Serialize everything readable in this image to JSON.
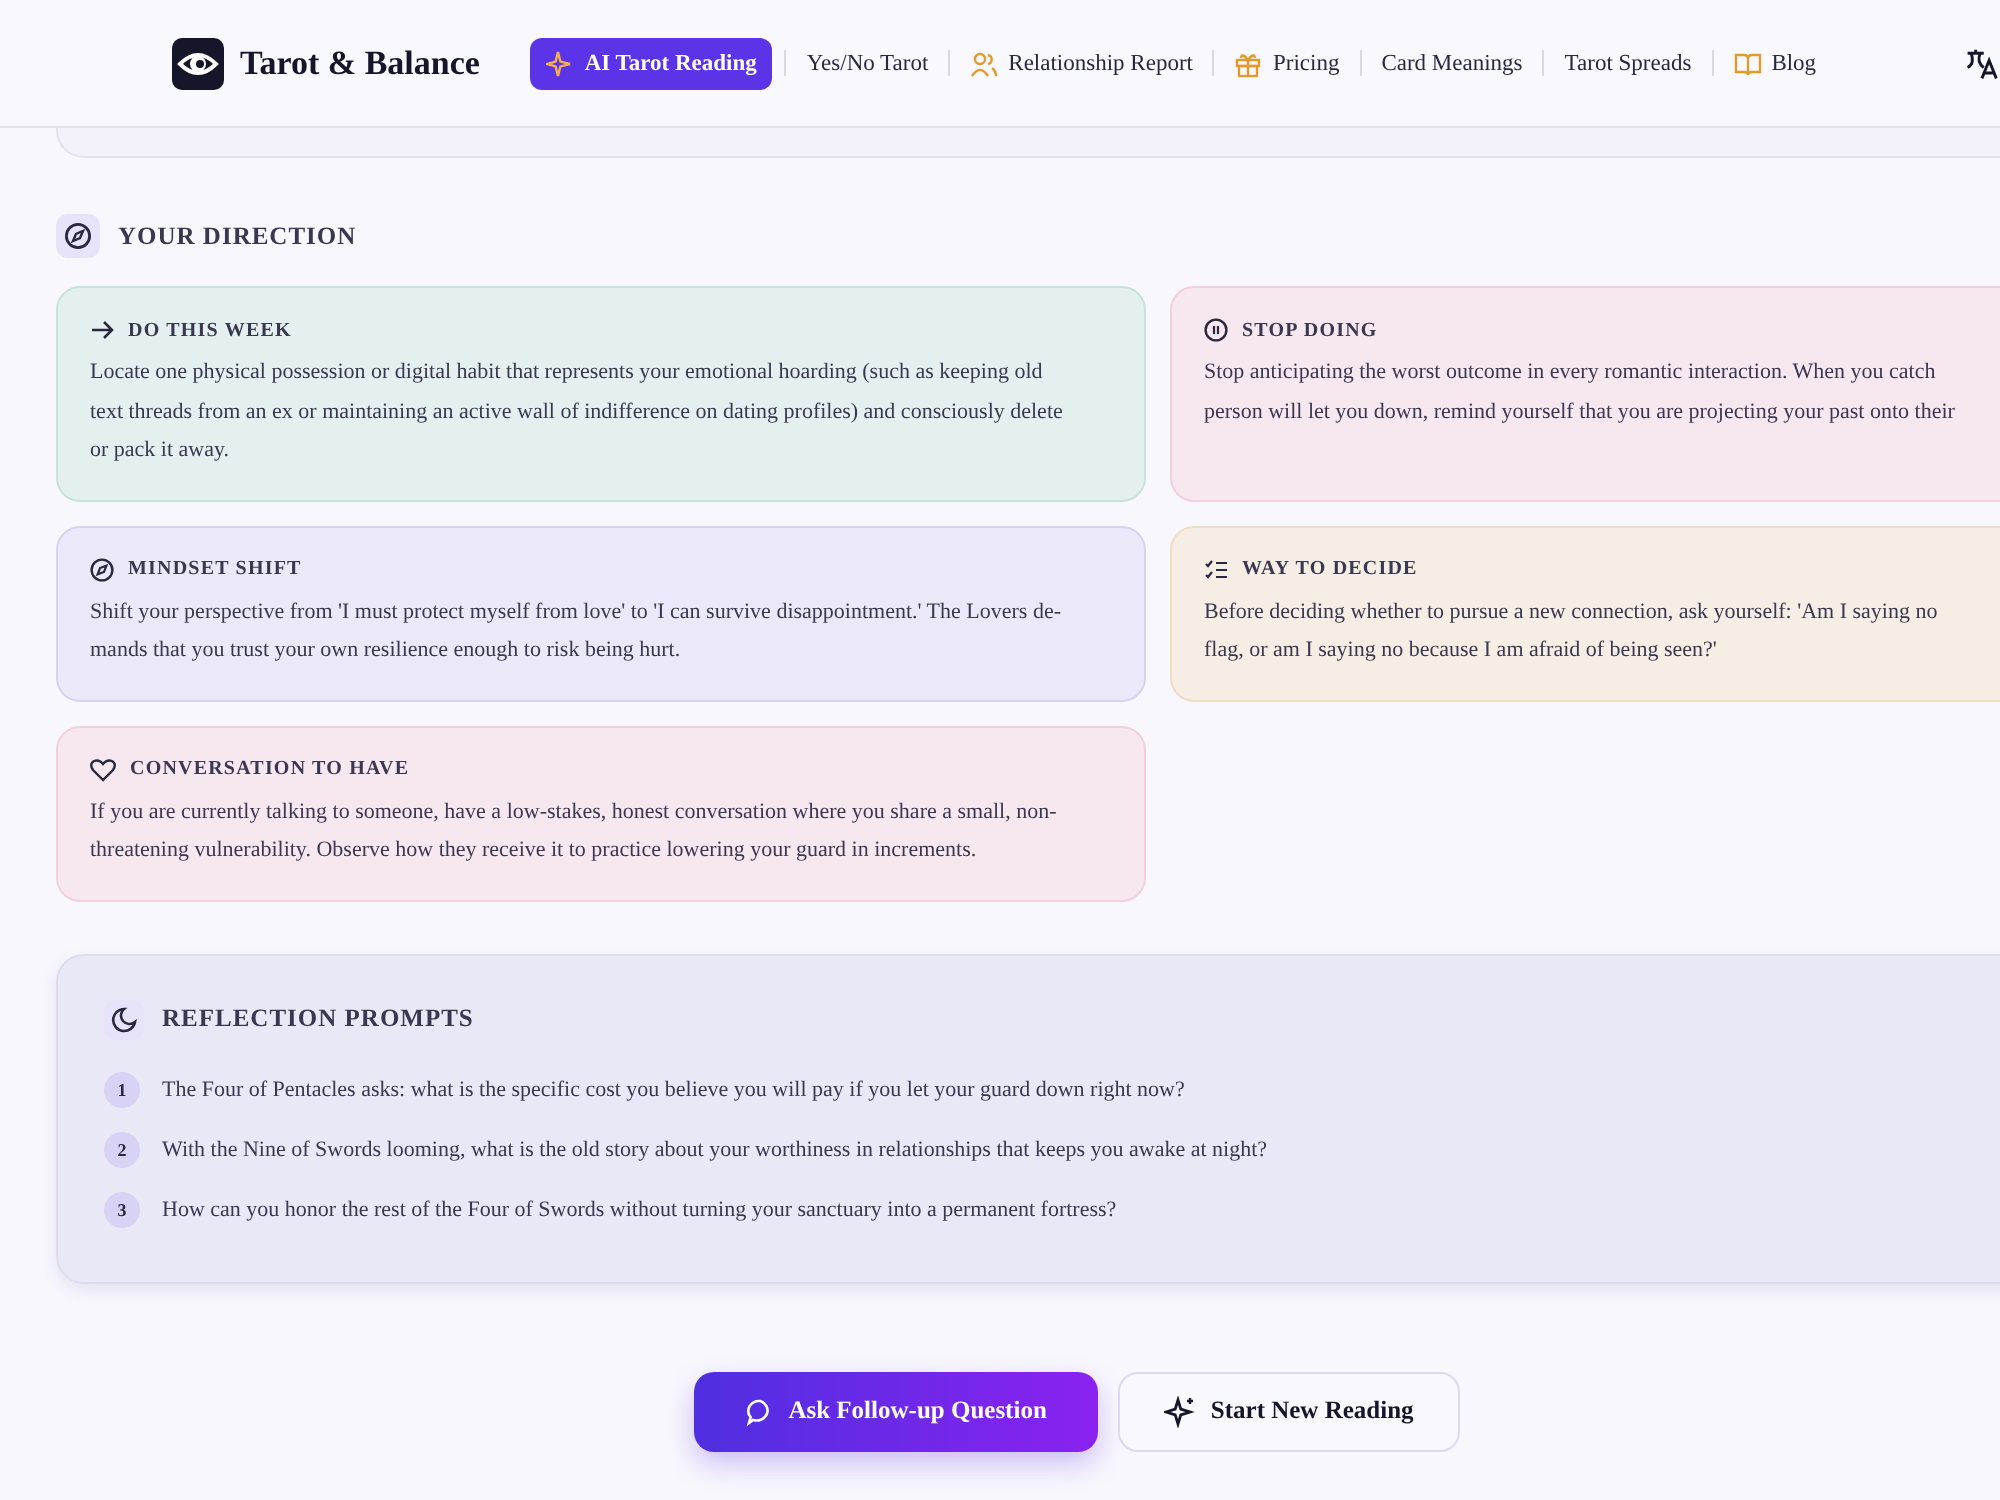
{
  "header": {
    "brand": "Tarot & Balance",
    "nav": [
      {
        "label": "AI Tarot Reading",
        "kind": "sparkle",
        "selected": true
      },
      {
        "label": "Yes/No Tarot",
        "kind": "plain",
        "selected": false
      },
      {
        "label": "Relationship Report",
        "kind": "people",
        "selected": false
      },
      {
        "label": "Pricing",
        "kind": "gift",
        "selected": false
      },
      {
        "label": "Card Meanings",
        "kind": "plain",
        "selected": false
      },
      {
        "label": "Tarot Spreads",
        "kind": "plain",
        "selected": false
      },
      {
        "label": "Blog",
        "kind": "book",
        "selected": false
      }
    ]
  },
  "direction": {
    "title": "YOUR DIRECTION",
    "cards": [
      {
        "kind": "arrow",
        "color": "#c5e3db",
        "title": "DO THIS WEEK",
        "lines": [
          "Locate one physical possession or digital habit that represents your emotional hoarding (such as keeping old",
          "text threads from an ex or maintaining an active wall of indifference on dating profiles) and consciously delete",
          "or pack it away."
        ]
      },
      {
        "kind": "pause",
        "color": "#f2cfdc",
        "title": "STOP DOING",
        "lines": [
          "Stop anticipating the worst outcome in every romantic interaction. When you catch",
          "person will let you down, remind yourself that you are projecting your past onto their"
        ]
      },
      {
        "kind": "compass",
        "color": "#d6d3f1",
        "title": "MINDSET SHIFT",
        "lines": [
          "Shift your perspective from 'I must protect myself from love' to 'I can survive disappointment.' The Lovers de-",
          "mands that you trust your own resilience enough to risk being hurt."
        ]
      },
      {
        "kind": "checklist",
        "color": "#efdcc4",
        "title": "WAY TO DECIDE",
        "lines": [
          "Before deciding whether to pursue a new connection, ask yourself: 'Am I saying no",
          "flag, or am I saying no because I am afraid of being seen?'"
        ]
      },
      {
        "kind": "heart",
        "color": "#f2cfdc",
        "title": "CONVERSATION TO HAVE",
        "lines": [
          "If you are currently talking to someone, have a low-stakes, honest conversation where you share a small, non-",
          "threatening vulnerability. Observe how they receive it to practice lowering your guard in increments."
        ]
      }
    ]
  },
  "reflection": {
    "title": "REFLECTION PROMPTS",
    "prompts": [
      {
        "number": "1",
        "text": "The Four of Pentacles asks: what is the specific cost you believe you will pay if you let your guard down right now?"
      },
      {
        "number": "2",
        "text": "With the Nine of Swords looming, what is the old story about your worthiness in relationships that keeps you awake at night?"
      },
      {
        "number": "3",
        "text": "How can you honor the rest of the Four of Swords without turning your sanctuary into a permanent fortress?"
      }
    ]
  },
  "actions": [
    {
      "label": "Ask Follow-up Question",
      "kind": "primary"
    },
    {
      "label": "Start New Reading",
      "kind": "secondary"
    }
  ]
}
